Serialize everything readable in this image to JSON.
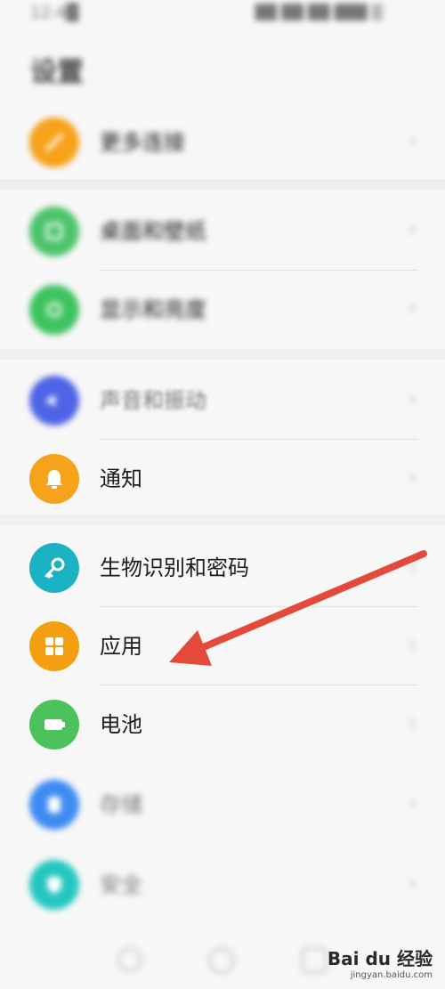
{
  "status_bar": {
    "time": "12:4█",
    "right_indicators": "██ ██ ██ ███ ▒"
  },
  "title": "设置",
  "items": [
    {
      "id": "more-connections",
      "label": "更多连接",
      "color": "#f6a21a",
      "icon": "link-icon",
      "blurred": true
    },
    {
      "id": "desktop-wallpaper",
      "label": "桌面和壁纸",
      "color": "#4cc46b",
      "icon": "wallpaper-icon",
      "blurred": true
    },
    {
      "id": "display-brightness",
      "label": "显示和亮度",
      "color": "#3fc35f",
      "icon": "brightness-icon",
      "blurred": true
    },
    {
      "id": "sound-vibration",
      "label": "声音和振动",
      "color": "#4f63e6",
      "icon": "sound-icon",
      "blurred": true
    },
    {
      "id": "notifications",
      "label": "通知",
      "color": "#f6a21a",
      "icon": "bell-icon",
      "blurred": false
    },
    {
      "id": "biometrics-password",
      "label": "生物识别和密码",
      "color": "#1bb2c4",
      "icon": "key-icon",
      "blurred": false
    },
    {
      "id": "apps",
      "label": "应用",
      "color": "#f49f11",
      "icon": "apps-grid-icon",
      "blurred": false
    },
    {
      "id": "battery",
      "label": "电池",
      "color": "#4cc25d",
      "icon": "battery-icon",
      "blurred": false
    },
    {
      "id": "storage",
      "label": "存储",
      "color": "#3d8bf2",
      "icon": "storage-icon",
      "blurred": true
    },
    {
      "id": "security",
      "label": "安全",
      "color": "#26c6c0",
      "icon": "shield-icon",
      "blurred": true
    }
  ],
  "chevron_glyph": "›",
  "watermark": {
    "brand": "Bai du 经验",
    "url": "jingyan.baidu.com"
  },
  "annotation": {
    "color": "#e44a3b",
    "target": "apps"
  }
}
